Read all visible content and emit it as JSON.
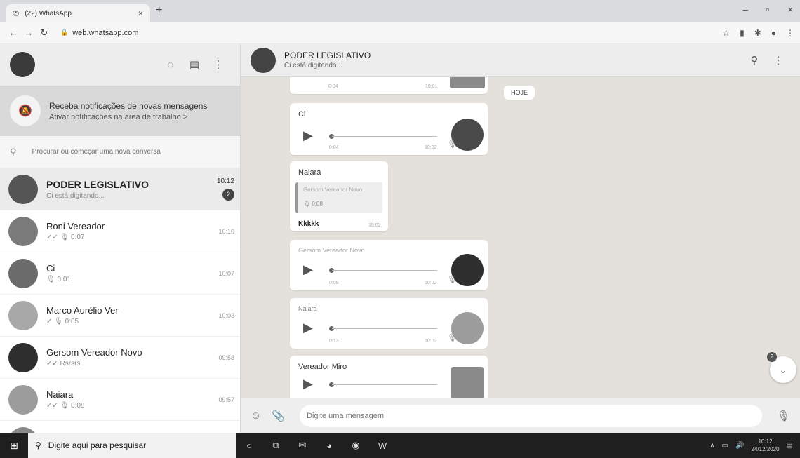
{
  "browser": {
    "tab_title": "(22) WhatsApp",
    "tab_close": "×",
    "new_tab": "+",
    "url": "web.whatsapp.com",
    "win_minimize": "–",
    "win_restore": "▫",
    "win_close": "×"
  },
  "sidebar": {
    "notification": {
      "title": "Receba notificações de novas mensagens",
      "link": "Ativar notificações na área de trabalho >"
    },
    "search_placeholder": "Procurar ou começar uma nova conversa",
    "chats": [
      {
        "name": "PODER LEGISLATIVO",
        "subtitle": "Ci está digitando...",
        "time": "10:12",
        "unread": "2",
        "color": "#555555"
      },
      {
        "name": "Roni Vereador",
        "subtitle": "✓✓ 🎙 0:07",
        "time": "10:10",
        "unread": "",
        "color": "#7a7a7a"
      },
      {
        "name": "Ci",
        "subtitle": "🎙 0:01",
        "time": "10:07",
        "unread": "",
        "color": "#6b6b6b"
      },
      {
        "name": "Marco Aurélio Ver",
        "subtitle": "✓ 🎙 0:05",
        "time": "10:03",
        "unread": "",
        "color": "#a8a8a8"
      },
      {
        "name": "Gersom Vereador Novo",
        "subtitle": "✓✓ Rsrsrs",
        "time": "09:58",
        "unread": "",
        "color": "#2e2e2e"
      },
      {
        "name": "Naiara",
        "subtitle": "✓✓ 🎙 0:08",
        "time": "09:57",
        "unread": "",
        "color": "#9c9c9c"
      },
      {
        "name": "Vereador Miro",
        "subtitle": "",
        "time": "09:57",
        "unread": "",
        "color": "#8a8a8a"
      }
    ]
  },
  "conversation": {
    "name": "PODER LEGISLATIVO",
    "status": "Ci está digitando...",
    "date_chip": "HOJE",
    "messages": [
      {
        "sender": "",
        "duration": "0:04",
        "time": "10:01"
      },
      {
        "sender": "Ci",
        "duration": "0:04",
        "time": "10:02"
      },
      {
        "sender": "Naiara",
        "quoted_name": "Gersom Vereador Novo",
        "quoted_duration": "🎙 0:08",
        "text": "Kkkkk",
        "time": "10:02"
      },
      {
        "sender": "Gersom Vereador Novo",
        "duration": "0:08",
        "time": "10:02"
      },
      {
        "sender": "Naiara",
        "duration": "0:13",
        "time": "10:02"
      },
      {
        "sender": "Vereador Miro",
        "duration": "",
        "time": ""
      }
    ],
    "scroll_badge": "2",
    "composer_placeholder": "Digite uma mensagem"
  },
  "taskbar": {
    "search_placeholder": "Digite aqui para pesquisar",
    "time": "10:12",
    "date": "24/12/2020"
  }
}
